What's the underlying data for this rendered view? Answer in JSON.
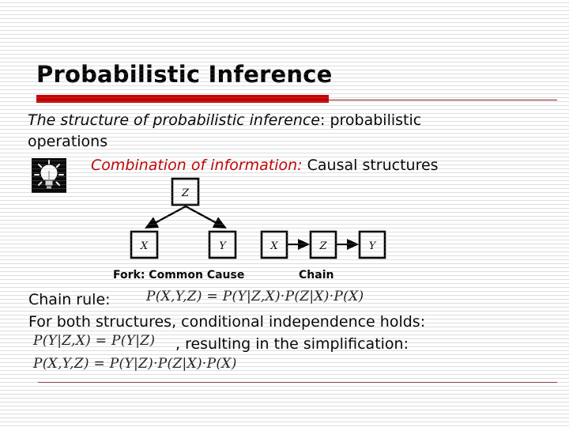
{
  "slide": {
    "title": "Probabilistic Inference",
    "accent_bar_color": "#C80000",
    "rule_color": "#7E1F1F",
    "red_text_color": "#C00000",
    "background_color": "#FFFFFF"
  },
  "body": {
    "line1_italic": "The structure of probabilistic inference",
    "line1_rest": ": probabilistic",
    "line2": "operations",
    "bullet_icon": "lightbulb-icon",
    "line3_red_italic": "Combination of information:",
    "line3_rest": " Causal structures"
  },
  "diagram": {
    "fork": {
      "caption": "Fork: Common Cause",
      "top_node": "Z",
      "left_node": "X",
      "right_node": "Y",
      "edges": [
        "Z->X",
        "Z->Y"
      ]
    },
    "chain": {
      "caption": "Chain",
      "nodes": [
        "X",
        "Z",
        "Y"
      ],
      "edges": [
        "X->Z",
        "Z->Y"
      ]
    }
  },
  "equations": {
    "chain_rule_label": "Chain rule:",
    "chain_rule_formula": "P(X,Y,Z) = P(Y|Z,X)·P(Z|X)·P(X)",
    "conditional_independence_text": "For both structures, conditional independence holds:",
    "conditional_independence_formula": "P(Y|Z,X) = P(Y|Z)",
    "resulting_text": ", resulting in the simplification:",
    "simplified_formula": "P(X,Y,Z) = P(Y|Z)·P(Z|X)·P(X)"
  }
}
